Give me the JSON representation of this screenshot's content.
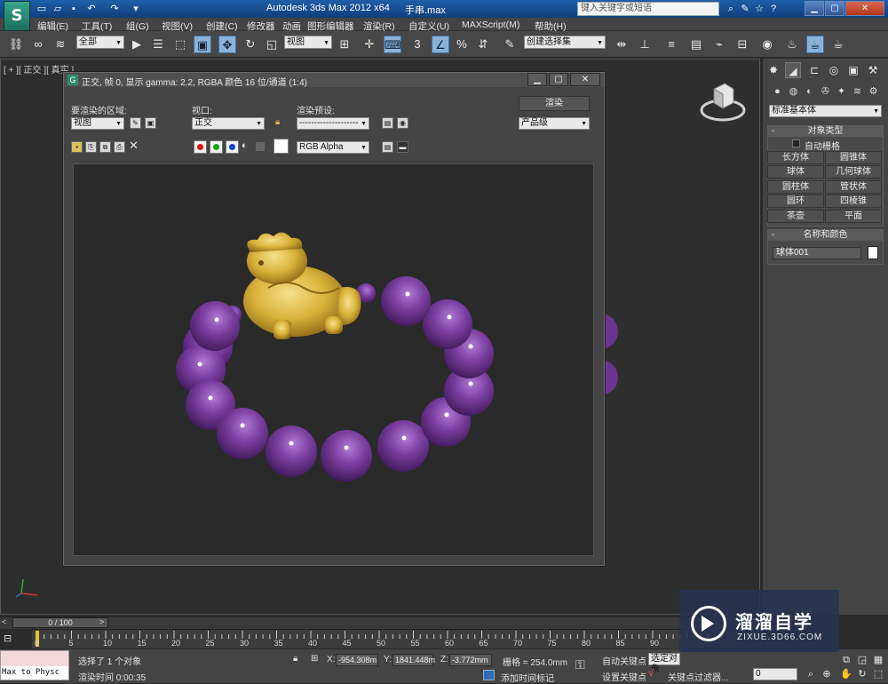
{
  "app": {
    "title": "Autodesk 3ds Max  2012 x64",
    "file": "手串.max",
    "search_placeholder": "键入关键字或短语"
  },
  "menubar": {
    "items": [
      "编辑(E)",
      "工具(T)",
      "组(G)",
      "视图(V)",
      "创建(C)",
      "修改器",
      "动画",
      "图形编辑器",
      "渲染(R)",
      "自定义(U)",
      "MAXScript(M)",
      "帮助(H)"
    ]
  },
  "toolbar": {
    "selection_filter": "全部",
    "ref_coord": "视图",
    "named_selection": "创建选择集"
  },
  "viewport": {
    "label": "[ + ][ 正交 ][ 真实 ]"
  },
  "render_window": {
    "title": "正交, 帧 0, 显示 gamma: 2.2, RGBA 颜色 16 位/通道 (1:4)",
    "area_label": "要渲染的区域:",
    "area_value": "视图",
    "viewport_label": "视口:",
    "viewport_value": "正交",
    "preset_label": "渲染预设:",
    "preset_value": "--------------------",
    "render_button": "渲染",
    "quality_value": "产品级",
    "channel_value": "RGB Alpha"
  },
  "command_panel": {
    "category": "标准基本体",
    "object_type_header": "对象类型",
    "autogrid_label": "自动栅格",
    "object_buttons": [
      "长方体",
      "圆锥体",
      "球体",
      "几何球体",
      "圆柱体",
      "管状体",
      "圆环",
      "四棱锥",
      "茶壶",
      "平面"
    ],
    "name_color_header": "名称和颜色",
    "object_name": "球体001"
  },
  "timeline": {
    "frame_display": "0 / 100",
    "ticks": [
      "0",
      "5",
      "10",
      "15",
      "20",
      "25",
      "30",
      "35",
      "40",
      "45",
      "50",
      "55",
      "60",
      "65",
      "70",
      "75",
      "80",
      "85",
      "90"
    ]
  },
  "statusbar": {
    "maxscript_text": "Max to Physc",
    "selection_status": "选择了 1 个对象",
    "render_time": "渲染时间 0:00:35",
    "x_label": "X:",
    "x_value": "-954.308m",
    "y_label": "Y:",
    "y_value": "1841.448m",
    "z_label": "Z:",
    "z_value": "-3.772mm",
    "grid_value": "栅格 = 254.0mm",
    "add_time_tag": "添加时间标记",
    "auto_key": "自动关键点",
    "set_key": "设置关键点",
    "selected_object": "选定对象",
    "key_filter": "关键点过滤器...",
    "frame_value": "0"
  },
  "watermark": {
    "title": "溜溜自学",
    "subtitle": "ZIXUE.3D66.COM"
  },
  "colors": {
    "bead_purple": "#7a3fa0",
    "pixiu_gold": "#d9b23a",
    "accent_blue": "#2f6db5"
  }
}
